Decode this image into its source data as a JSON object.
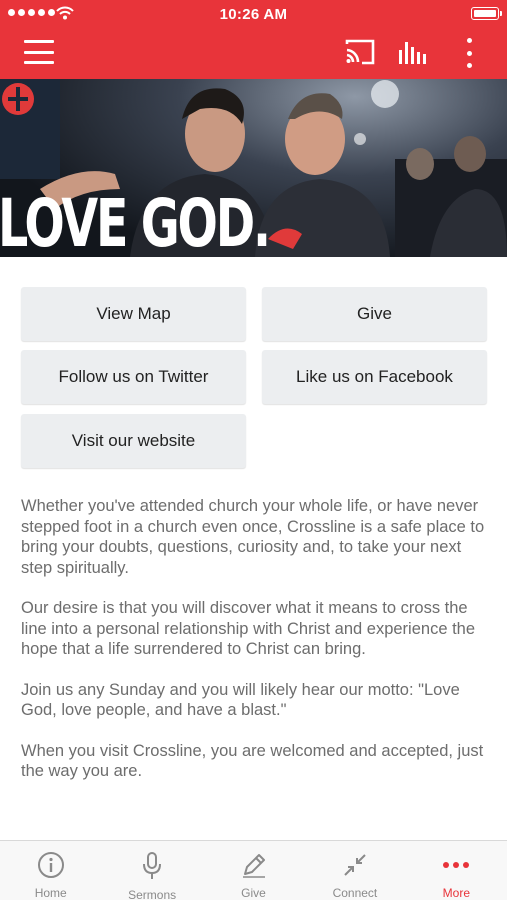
{
  "status_bar": {
    "time": "10:26 AM"
  },
  "header": {
    "menu_icon": "hamburger-menu-icon",
    "cast_icon": "cast-icon",
    "audio_icon": "audio-bars-icon",
    "more_icon": "vertical-more-icon",
    "brand_color": "#e8343a"
  },
  "hero": {
    "text": "LOVE GOD."
  },
  "buttons": {
    "view_map": "View Map",
    "give": "Give",
    "twitter": "Follow us on Twitter",
    "facebook": "Like us on Facebook",
    "website": "Visit our website"
  },
  "content": {
    "paragraphs": [
      "Whether you've attended church your whole life, or have never stepped foot in a church even once, Crossline is a safe place to bring your doubts, questions, curiosity and, to take your next step spiritually.",
      "Our desire is that you will discover what it means to cross the line into a personal relationship with Christ and experience the hope that a life surrendered to Christ can bring.",
      "Join us any Sunday and you will likely hear our motto: \"Love God, love people, and have a blast.\"",
      "When you visit Crossline, you are welcomed and accepted, just the way you are."
    ]
  },
  "tabbar": {
    "tabs": [
      {
        "label": "Home",
        "icon": "info-circle-icon"
      },
      {
        "label": "Sermons",
        "icon": "microphone-icon"
      },
      {
        "label": "Give",
        "icon": "pen-icon"
      },
      {
        "label": "Connect",
        "icon": "compress-arrows-icon"
      },
      {
        "label": "More",
        "icon": "horizontal-dots-icon",
        "active": true
      }
    ],
    "active_color": "#e8343a",
    "inactive_color": "#8a8a8a"
  }
}
